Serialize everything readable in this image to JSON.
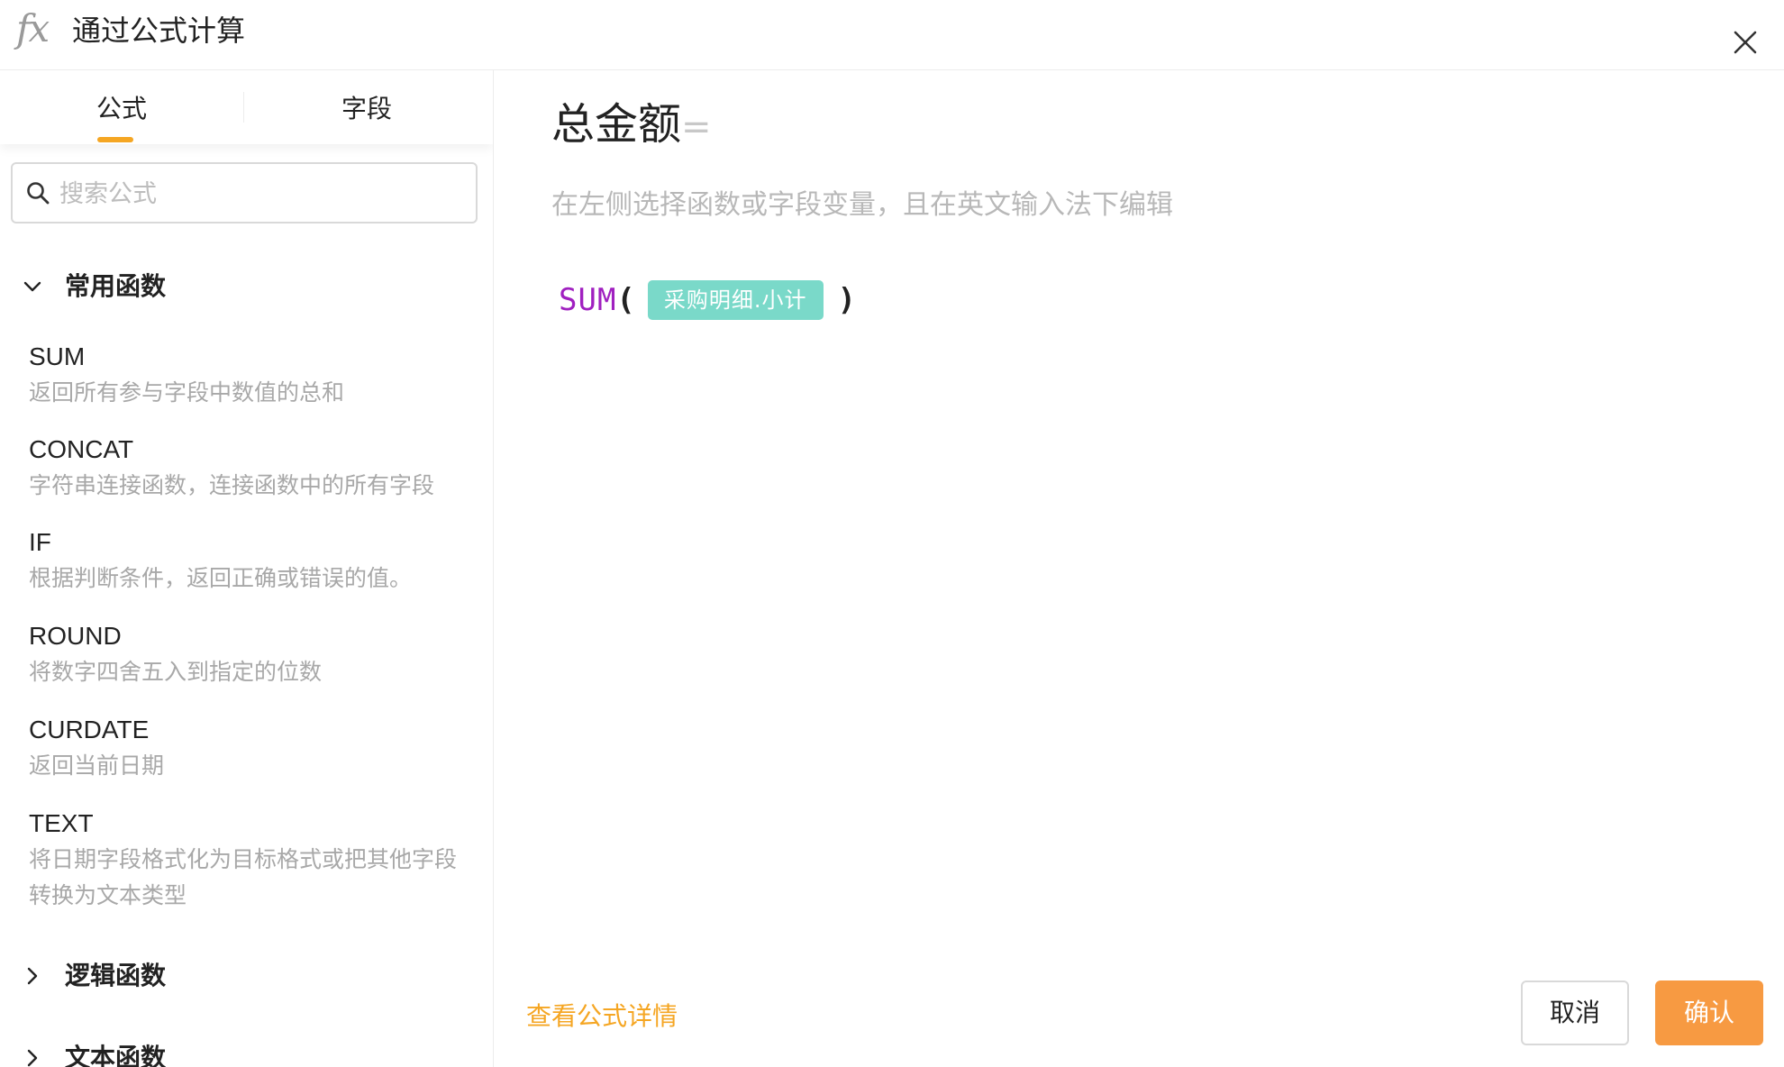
{
  "header": {
    "icon_label": "fx",
    "title": "通过公式计算"
  },
  "tabs": [
    {
      "label": "公式",
      "active": true
    },
    {
      "label": "字段",
      "active": false
    }
  ],
  "search": {
    "placeholder": "搜索公式",
    "value": ""
  },
  "categories": [
    {
      "label": "常用函数",
      "expanded": true,
      "functions": [
        {
          "name": "SUM",
          "description": "返回所有参与字段中数值的总和"
        },
        {
          "name": "CONCAT",
          "description": "字符串连接函数，连接函数中的所有字段"
        },
        {
          "name": "IF",
          "description": "根据判断条件，返回正确或错误的值。"
        },
        {
          "name": "ROUND",
          "description": "将数字四舍五入到指定的位数"
        },
        {
          "name": "CURDATE",
          "description": "返回当前日期"
        },
        {
          "name": "TEXT",
          "description": "将日期字段格式化为目标格式或把其他字段转换为文本类型"
        }
      ]
    },
    {
      "label": "逻辑函数",
      "expanded": false
    },
    {
      "label": "文本函数",
      "expanded": false
    }
  ],
  "editor": {
    "field_name": "总金额",
    "equals": "=",
    "hint": "在左侧选择函数或字段变量，且在英文输入法下编辑",
    "formula": {
      "function": "SUM",
      "open_paren": "(",
      "argument": "采购明细.小计",
      "close_paren": ")"
    }
  },
  "footer": {
    "detail_link": "查看公式详情",
    "cancel_label": "取消",
    "confirm_label": "确认"
  },
  "colors": {
    "accent": "#f5a623",
    "confirm": "#f79a42",
    "function_name": "#a020c0",
    "field_tag": "#7ad9c9"
  }
}
